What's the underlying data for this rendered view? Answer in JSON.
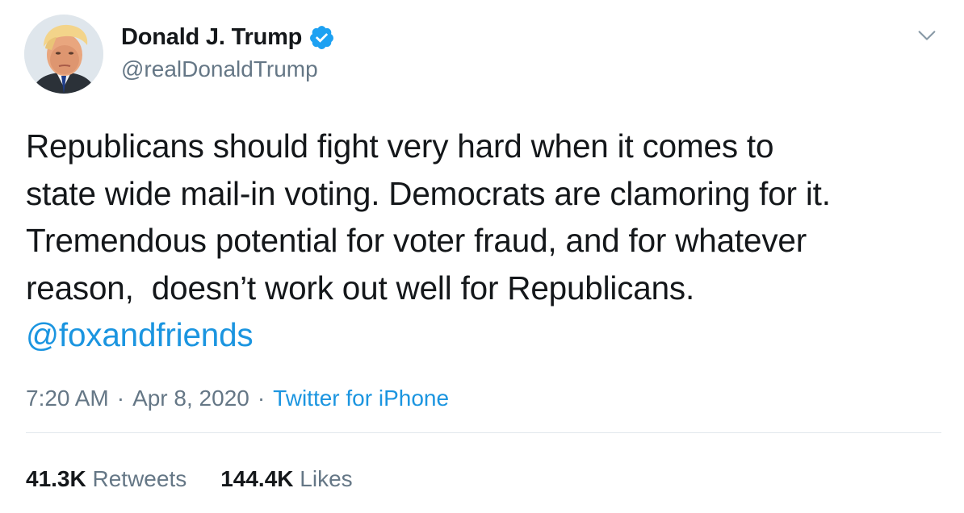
{
  "colors": {
    "text_primary": "#14171a",
    "text_secondary": "#657786",
    "link": "#1b95e0",
    "verified_badge": "#1da1f2",
    "divider": "#e1e8ed"
  },
  "author": {
    "display_name": "Donald J. Trump",
    "handle": "@realDonaldTrump",
    "verified": true,
    "avatar_icon": "profile-photo",
    "verified_icon": "verified-badge-icon"
  },
  "menu": {
    "icon": "chevron-down-icon"
  },
  "tweet": {
    "lines": [
      "Republicans should fight very hard when it comes to",
      "state wide mail-in voting. Democrats are clamoring for it.",
      "Tremendous potential for voter fraud, and for whatever",
      "reason,  doesn’t work out well for Republicans."
    ],
    "mention": "@foxandfriends"
  },
  "meta": {
    "time": "7:20 AM",
    "separator": "·",
    "date": "Apr 8, 2020",
    "source": "Twitter for iPhone"
  },
  "stats": {
    "retweets_count": "41.3K",
    "retweets_label": "Retweets",
    "likes_count": "144.4K",
    "likes_label": "Likes"
  }
}
